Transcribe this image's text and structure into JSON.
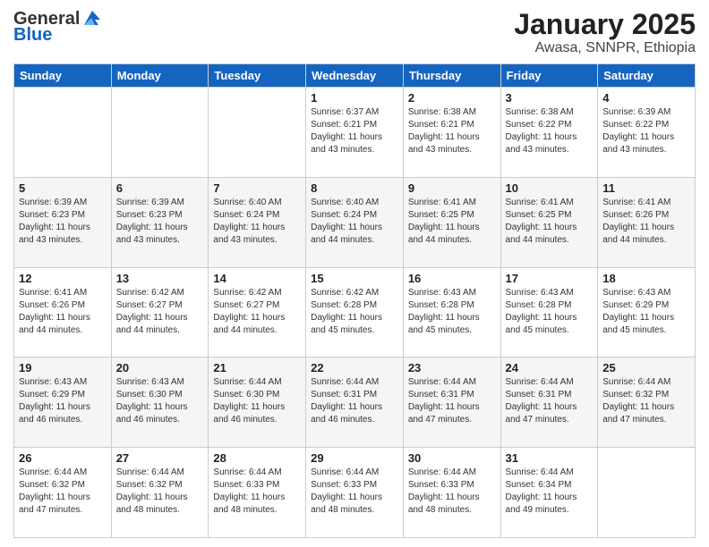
{
  "header": {
    "logo_general": "General",
    "logo_blue": "Blue",
    "month": "January 2025",
    "location": "Awasa, SNNPR, Ethiopia"
  },
  "days_of_week": [
    "Sunday",
    "Monday",
    "Tuesday",
    "Wednesday",
    "Thursday",
    "Friday",
    "Saturday"
  ],
  "weeks": [
    [
      {
        "day": "",
        "info": ""
      },
      {
        "day": "",
        "info": ""
      },
      {
        "day": "",
        "info": ""
      },
      {
        "day": "1",
        "info": "Sunrise: 6:37 AM\nSunset: 6:21 PM\nDaylight: 11 hours\nand 43 minutes."
      },
      {
        "day": "2",
        "info": "Sunrise: 6:38 AM\nSunset: 6:21 PM\nDaylight: 11 hours\nand 43 minutes."
      },
      {
        "day": "3",
        "info": "Sunrise: 6:38 AM\nSunset: 6:22 PM\nDaylight: 11 hours\nand 43 minutes."
      },
      {
        "day": "4",
        "info": "Sunrise: 6:39 AM\nSunset: 6:22 PM\nDaylight: 11 hours\nand 43 minutes."
      }
    ],
    [
      {
        "day": "5",
        "info": "Sunrise: 6:39 AM\nSunset: 6:23 PM\nDaylight: 11 hours\nand 43 minutes."
      },
      {
        "day": "6",
        "info": "Sunrise: 6:39 AM\nSunset: 6:23 PM\nDaylight: 11 hours\nand 43 minutes."
      },
      {
        "day": "7",
        "info": "Sunrise: 6:40 AM\nSunset: 6:24 PM\nDaylight: 11 hours\nand 43 minutes."
      },
      {
        "day": "8",
        "info": "Sunrise: 6:40 AM\nSunset: 6:24 PM\nDaylight: 11 hours\nand 44 minutes."
      },
      {
        "day": "9",
        "info": "Sunrise: 6:41 AM\nSunset: 6:25 PM\nDaylight: 11 hours\nand 44 minutes."
      },
      {
        "day": "10",
        "info": "Sunrise: 6:41 AM\nSunset: 6:25 PM\nDaylight: 11 hours\nand 44 minutes."
      },
      {
        "day": "11",
        "info": "Sunrise: 6:41 AM\nSunset: 6:26 PM\nDaylight: 11 hours\nand 44 minutes."
      }
    ],
    [
      {
        "day": "12",
        "info": "Sunrise: 6:41 AM\nSunset: 6:26 PM\nDaylight: 11 hours\nand 44 minutes."
      },
      {
        "day": "13",
        "info": "Sunrise: 6:42 AM\nSunset: 6:27 PM\nDaylight: 11 hours\nand 44 minutes."
      },
      {
        "day": "14",
        "info": "Sunrise: 6:42 AM\nSunset: 6:27 PM\nDaylight: 11 hours\nand 44 minutes."
      },
      {
        "day": "15",
        "info": "Sunrise: 6:42 AM\nSunset: 6:28 PM\nDaylight: 11 hours\nand 45 minutes."
      },
      {
        "day": "16",
        "info": "Sunrise: 6:43 AM\nSunset: 6:28 PM\nDaylight: 11 hours\nand 45 minutes."
      },
      {
        "day": "17",
        "info": "Sunrise: 6:43 AM\nSunset: 6:28 PM\nDaylight: 11 hours\nand 45 minutes."
      },
      {
        "day": "18",
        "info": "Sunrise: 6:43 AM\nSunset: 6:29 PM\nDaylight: 11 hours\nand 45 minutes."
      }
    ],
    [
      {
        "day": "19",
        "info": "Sunrise: 6:43 AM\nSunset: 6:29 PM\nDaylight: 11 hours\nand 46 minutes."
      },
      {
        "day": "20",
        "info": "Sunrise: 6:43 AM\nSunset: 6:30 PM\nDaylight: 11 hours\nand 46 minutes."
      },
      {
        "day": "21",
        "info": "Sunrise: 6:44 AM\nSunset: 6:30 PM\nDaylight: 11 hours\nand 46 minutes."
      },
      {
        "day": "22",
        "info": "Sunrise: 6:44 AM\nSunset: 6:31 PM\nDaylight: 11 hours\nand 46 minutes."
      },
      {
        "day": "23",
        "info": "Sunrise: 6:44 AM\nSunset: 6:31 PM\nDaylight: 11 hours\nand 47 minutes."
      },
      {
        "day": "24",
        "info": "Sunrise: 6:44 AM\nSunset: 6:31 PM\nDaylight: 11 hours\nand 47 minutes."
      },
      {
        "day": "25",
        "info": "Sunrise: 6:44 AM\nSunset: 6:32 PM\nDaylight: 11 hours\nand 47 minutes."
      }
    ],
    [
      {
        "day": "26",
        "info": "Sunrise: 6:44 AM\nSunset: 6:32 PM\nDaylight: 11 hours\nand 47 minutes."
      },
      {
        "day": "27",
        "info": "Sunrise: 6:44 AM\nSunset: 6:32 PM\nDaylight: 11 hours\nand 48 minutes."
      },
      {
        "day": "28",
        "info": "Sunrise: 6:44 AM\nSunset: 6:33 PM\nDaylight: 11 hours\nand 48 minutes."
      },
      {
        "day": "29",
        "info": "Sunrise: 6:44 AM\nSunset: 6:33 PM\nDaylight: 11 hours\nand 48 minutes."
      },
      {
        "day": "30",
        "info": "Sunrise: 6:44 AM\nSunset: 6:33 PM\nDaylight: 11 hours\nand 48 minutes."
      },
      {
        "day": "31",
        "info": "Sunrise: 6:44 AM\nSunset: 6:34 PM\nDaylight: 11 hours\nand 49 minutes."
      },
      {
        "day": "",
        "info": ""
      }
    ]
  ]
}
